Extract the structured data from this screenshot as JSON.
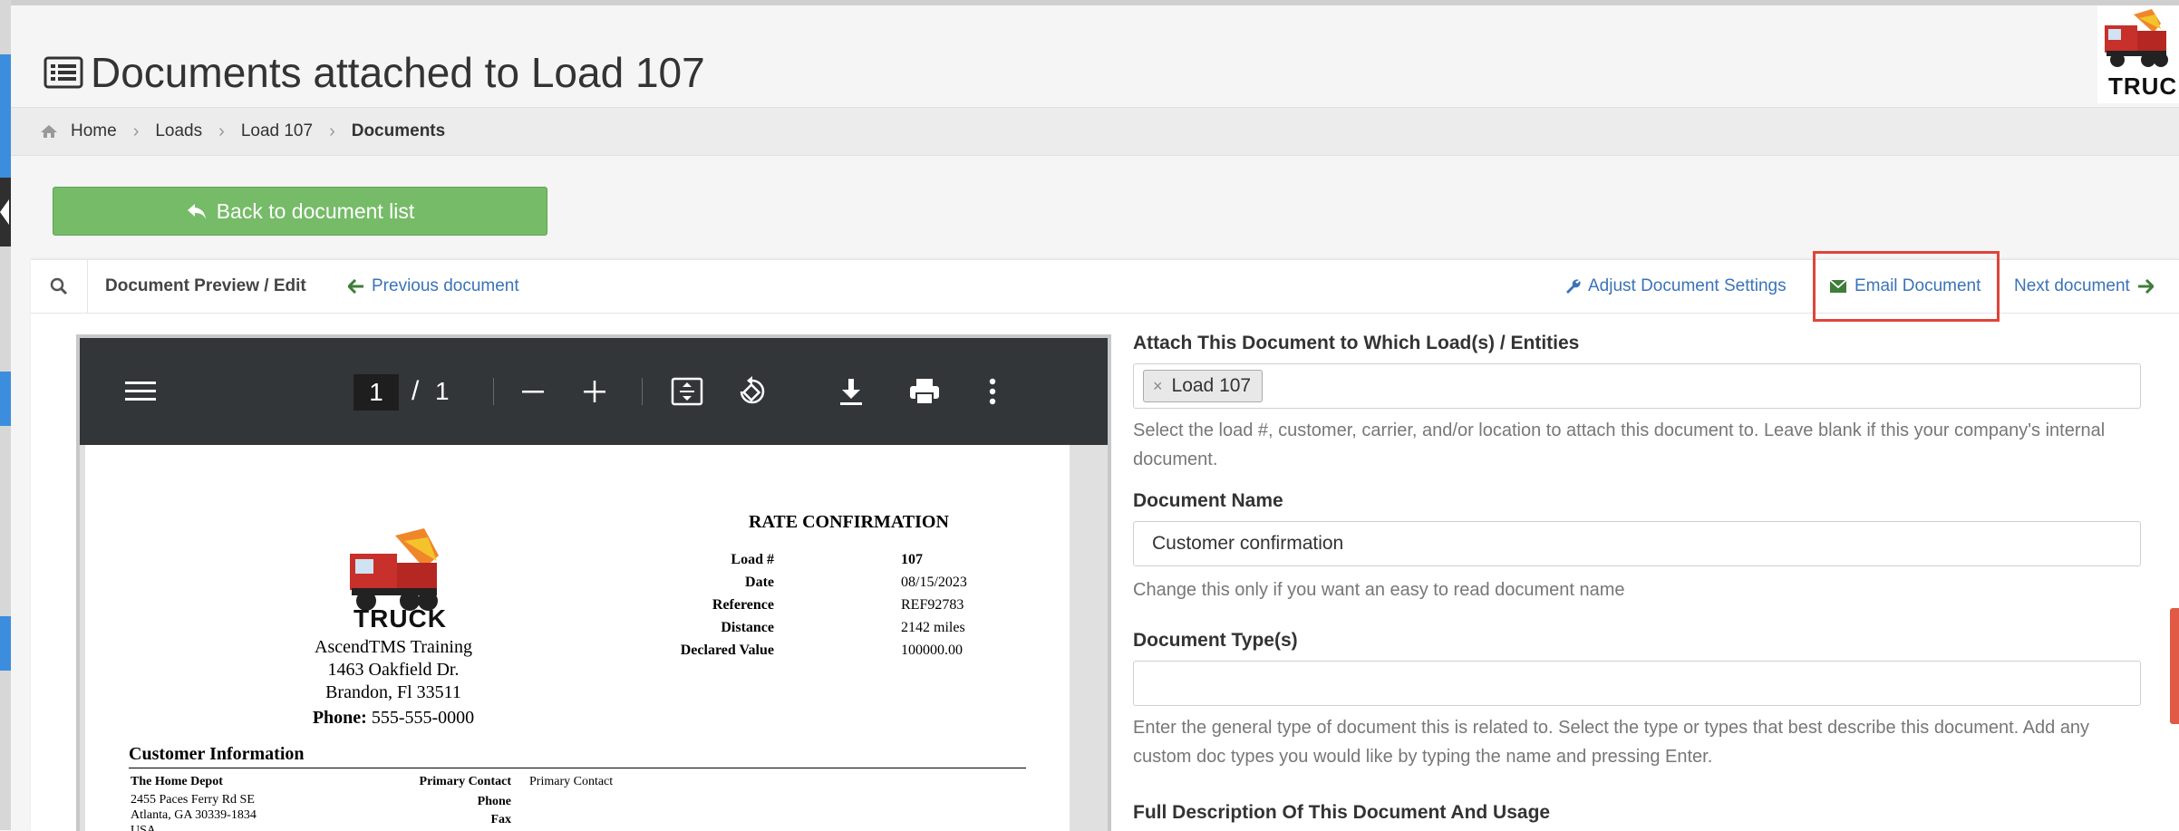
{
  "page": {
    "title": "Documents attached to Load 107"
  },
  "logo": {
    "text": "TRUCK"
  },
  "breadcrumb": {
    "items": [
      "Home",
      "Loads",
      "Load 107"
    ],
    "current": "Documents"
  },
  "back_button": {
    "label": "Back to document list"
  },
  "toolbar": {
    "label": "Document Preview / Edit",
    "previous": "Previous document",
    "adjust": "Adjust Document Settings",
    "email": "Email Document",
    "next": "Next document"
  },
  "viewer": {
    "page_current": "1",
    "page_separator": "/",
    "page_total": "1"
  },
  "document": {
    "logo_text": "TRUCK",
    "rc_title": "RATE CONFIRMATION",
    "fields": [
      {
        "label": "Load #",
        "value": "107"
      },
      {
        "label": "Date",
        "value": "08/15/2023"
      },
      {
        "label": "Reference",
        "value": "REF92783"
      },
      {
        "label": "Distance",
        "value": "2142 miles"
      },
      {
        "label": "Declared Value",
        "value": "100000.00"
      }
    ],
    "company": {
      "name": "AscendTMS Training",
      "address1": "1463 Oakfield Dr.",
      "address2": "Brandon, Fl 33511",
      "phone_label": "Phone:",
      "phone": "555-555-0000"
    },
    "customer_header": "Customer Information",
    "customer_name": "The Home Depot",
    "customer_addr1": "2455 Paces Ferry Rd SE",
    "customer_addr2": "Atlanta, GA 30339-1834",
    "customer_addr3": "USA",
    "primary_contact_label": "Primary Contact",
    "primary_contact_value": "Primary Contact",
    "phone_label": "Phone",
    "fax_label": "Fax"
  },
  "form": {
    "attach_label": "Attach This Document to Which Load(s) / Entities",
    "attach_tag": "Load 107",
    "attach_tag_remove": "×",
    "attach_help": "Select the load #, customer, carrier, and/or location to attach this document to. Leave blank if this your company's internal document.",
    "name_label": "Document Name",
    "name_value": "Customer confirmation",
    "name_help": "Change this only if you want an easy to read document name",
    "type_label": "Document Type(s)",
    "type_value": "",
    "type_help": "Enter the general type of document this is related to. Select the type or types that best describe this document. Add any custom doc types you would like by typing the name and pressing Enter.",
    "desc_label": "Full Description Of This Document And Usage"
  },
  "colors": {
    "primary_link": "#3a73b8",
    "back_button": "#76bb68",
    "highlight_box": "#e0443a",
    "viewer_bar": "#323639"
  }
}
